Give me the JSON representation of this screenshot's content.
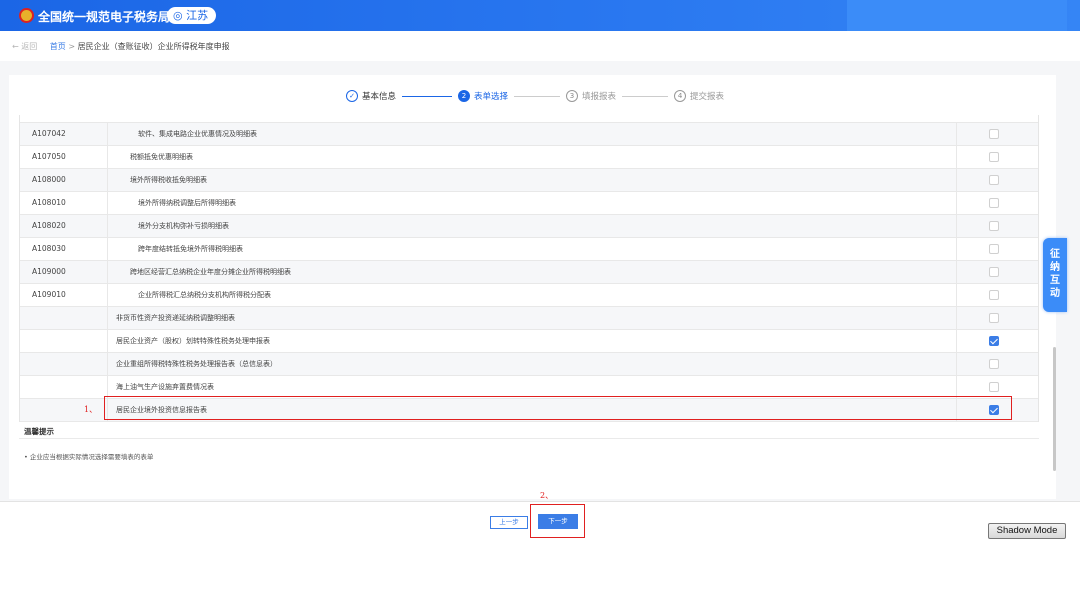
{
  "header": {
    "site_title": "全国统一规范电子税务局",
    "region": "◎ 江苏"
  },
  "breadcrumb": {
    "back": "← 返回",
    "home": "首页",
    "separator": ">",
    "current": "居民企业（查账征收）企业所得税年度申报"
  },
  "steps": [
    {
      "num": "✓",
      "label": "基本信息",
      "state": "done"
    },
    {
      "num": "2",
      "label": "表单选择",
      "state": "active"
    },
    {
      "num": "3",
      "label": "填报报表",
      "state": "todo"
    },
    {
      "num": "4",
      "label": "提交报表",
      "state": "todo"
    }
  ],
  "table": {
    "rows": [
      {
        "code": "A107042",
        "name": "软件、集成电路企业优惠情况及明细表",
        "indent": 3,
        "checked": false
      },
      {
        "code": "A107050",
        "name": "税额抵免优惠明细表",
        "indent": 2,
        "checked": false
      },
      {
        "code": "A108000",
        "name": "境外所得税收抵免明细表",
        "indent": 2,
        "checked": false
      },
      {
        "code": "A108010",
        "name": "境外所得纳税调整后所得明细表",
        "indent": 3,
        "checked": false
      },
      {
        "code": "A108020",
        "name": "境外分支机构弥补亏损明细表",
        "indent": 3,
        "checked": false
      },
      {
        "code": "A108030",
        "name": "跨年度结转抵免境外所得税明细表",
        "indent": 3,
        "checked": false
      },
      {
        "code": "A109000",
        "name": "跨地区经营汇总纳税企业年度分摊企业所得税明细表",
        "indent": 2,
        "checked": false
      },
      {
        "code": "A109010",
        "name": "企业所得税汇总纳税分支机构所得税分配表",
        "indent": 3,
        "checked": false
      },
      {
        "code": "",
        "name": "非货币性资产投资递延纳税调整明细表",
        "indent": 1,
        "checked": false
      },
      {
        "code": "",
        "name": "居民企业资产（股权）划转特殊性税务处理申报表",
        "indent": 1,
        "checked": true
      },
      {
        "code": "",
        "name": "企业重组所得税特殊性税务处理报告表（总信息表）",
        "indent": 1,
        "checked": false
      },
      {
        "code": "",
        "name": "海上油气生产设施弃置费情况表",
        "indent": 1,
        "checked": false
      },
      {
        "code": "",
        "name": "居民企业境外投资信息报告表",
        "indent": 1,
        "checked": true
      }
    ]
  },
  "annotations": {
    "mark1": "1、",
    "mark2": "2、"
  },
  "tips": {
    "title": "温馨提示",
    "items": [
      "• 企业应当根据实际情况选择需要填表的表单"
    ]
  },
  "side_tab": {
    "chars": [
      "征",
      "纳",
      "互",
      "动"
    ]
  },
  "buttons": {
    "prev": "上一步",
    "next": "下一步",
    "shadow_mode": "Shadow Mode"
  },
  "colors": {
    "brand_blue": "#1b66e6",
    "highlight_red": "#e02020"
  }
}
